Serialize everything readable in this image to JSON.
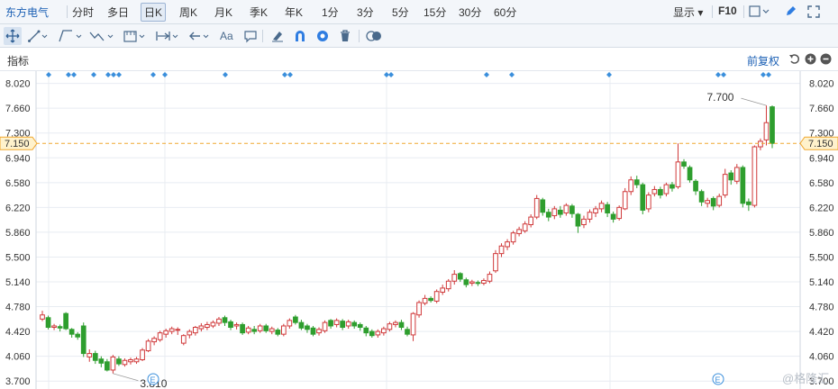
{
  "header": {
    "stock_name": "东方电气",
    "periods": [
      "分时",
      "多日",
      "日K",
      "周K",
      "月K",
      "季K",
      "年K",
      "1分",
      "3分",
      "5分",
      "15分",
      "30分",
      "60分"
    ],
    "active_period": "日K",
    "display_label": "显示",
    "f10_label": "F10"
  },
  "toolbar": {
    "text_tool_label": "Aa"
  },
  "indicator_bar": {
    "label": "指标",
    "adjust_label": "前复权"
  },
  "colors": {
    "up": "#d0393a",
    "down": "#2e9e2e",
    "grid": "#e8ecf2",
    "price_line": "#f0a830",
    "price_tag": "#fff2cc",
    "marker": "#3b8fdc"
  },
  "watermark": "@格隆汇",
  "chart_data": {
    "type": "candlestick",
    "y_ticks": [
      "8.020",
      "7.660",
      "7.300",
      "6.940",
      "6.580",
      "6.220",
      "5.860",
      "5.500",
      "5.140",
      "4.780",
      "4.420",
      "4.060",
      "3.700"
    ],
    "ylim": [
      3.585,
      8.198
    ],
    "current_price": "7.150",
    "high_label": "7.700",
    "low_label": "3.810",
    "event_marker_label": "E",
    "grid": true,
    "candles": [
      [
        4.6,
        4.66,
        4.57,
        4.72
      ],
      [
        4.62,
        4.48,
        4.45,
        4.65
      ],
      [
        4.48,
        4.5,
        4.44,
        4.53
      ],
      [
        4.49,
        4.47,
        4.42,
        4.52
      ],
      [
        4.68,
        4.46,
        4.44,
        4.7
      ],
      [
        4.45,
        4.38,
        4.33,
        4.47
      ],
      [
        4.38,
        4.34,
        4.3,
        4.41
      ],
      [
        4.5,
        4.1,
        4.05,
        4.55
      ],
      [
        4.05,
        4.1,
        3.98,
        4.16
      ],
      [
        4.1,
        4.0,
        3.95,
        4.14
      ],
      [
        4.02,
        3.96,
        3.9,
        4.06
      ],
      [
        3.98,
        3.86,
        3.84,
        4.02
      ],
      [
        3.86,
        4.05,
        3.81,
        4.08
      ],
      [
        4.02,
        3.95,
        3.92,
        4.06
      ],
      [
        3.94,
        4.0,
        3.91,
        4.03
      ],
      [
        3.98,
        4.01,
        3.94,
        4.04
      ],
      [
        3.98,
        4.02,
        3.95,
        4.05
      ],
      [
        4.01,
        4.15,
        3.99,
        4.18
      ],
      [
        4.14,
        4.28,
        4.12,
        4.31
      ],
      [
        4.27,
        4.32,
        4.22,
        4.35
      ],
      [
        4.3,
        4.4,
        4.27,
        4.43
      ],
      [
        4.38,
        4.43,
        4.33,
        4.46
      ],
      [
        4.42,
        4.46,
        4.38,
        4.49
      ],
      [
        4.44,
        4.45,
        4.37,
        4.48
      ],
      [
        4.25,
        4.36,
        4.22,
        4.38
      ],
      [
        4.37,
        4.42,
        4.32,
        4.45
      ],
      [
        4.4,
        4.48,
        4.36,
        4.5
      ],
      [
        4.46,
        4.5,
        4.42,
        4.54
      ],
      [
        4.48,
        4.52,
        4.44,
        4.56
      ],
      [
        4.5,
        4.55,
        4.47,
        4.58
      ],
      [
        4.54,
        4.6,
        4.5,
        4.63
      ],
      [
        4.62,
        4.55,
        4.5,
        4.65
      ],
      [
        4.56,
        4.48,
        4.44,
        4.59
      ],
      [
        4.5,
        4.52,
        4.45,
        4.55
      ],
      [
        4.52,
        4.4,
        4.37,
        4.55
      ],
      [
        4.41,
        4.47,
        4.38,
        4.5
      ],
      [
        4.45,
        4.42,
        4.38,
        4.5
      ],
      [
        4.43,
        4.5,
        4.4,
        4.53
      ],
      [
        4.5,
        4.43,
        4.4,
        4.53
      ],
      [
        4.42,
        4.46,
        4.38,
        4.49
      ],
      [
        4.44,
        4.38,
        4.35,
        4.47
      ],
      [
        4.38,
        4.5,
        4.35,
        4.53
      ],
      [
        4.5,
        4.58,
        4.46,
        4.61
      ],
      [
        4.63,
        4.55,
        4.52,
        4.66
      ],
      [
        4.55,
        4.47,
        4.44,
        4.59
      ],
      [
        4.5,
        4.45,
        4.4,
        4.53
      ],
      [
        4.47,
        4.38,
        4.35,
        4.5
      ],
      [
        4.4,
        4.45,
        4.36,
        4.48
      ],
      [
        4.43,
        4.55,
        4.4,
        4.58
      ],
      [
        4.58,
        4.5,
        4.46,
        4.6
      ],
      [
        4.52,
        4.58,
        4.48,
        4.61
      ],
      [
        4.57,
        4.48,
        4.44,
        4.6
      ],
      [
        4.5,
        4.56,
        4.46,
        4.59
      ],
      [
        4.55,
        4.5,
        4.46,
        4.58
      ],
      [
        4.52,
        4.48,
        4.43,
        4.55
      ],
      [
        4.47,
        4.4,
        4.35,
        4.5
      ],
      [
        4.42,
        4.36,
        4.33,
        4.45
      ],
      [
        4.37,
        4.42,
        4.33,
        4.45
      ],
      [
        4.4,
        4.46,
        4.36,
        4.49
      ],
      [
        4.45,
        4.53,
        4.42,
        4.56
      ],
      [
        4.52,
        4.55,
        4.48,
        4.58
      ],
      [
        4.55,
        4.48,
        4.44,
        4.59
      ],
      [
        4.45,
        4.38,
        4.35,
        4.49
      ],
      [
        4.37,
        4.68,
        4.28,
        4.7
      ],
      [
        4.66,
        4.84,
        4.62,
        4.87
      ],
      [
        4.83,
        4.9,
        4.8,
        4.95
      ],
      [
        4.9,
        4.87,
        4.84,
        4.93
      ],
      [
        4.86,
        5.0,
        4.83,
        5.03
      ],
      [
        4.99,
        5.05,
        4.95,
        5.1
      ],
      [
        5.04,
        5.15,
        5.0,
        5.18
      ],
      [
        5.15,
        5.25,
        5.1,
        5.31
      ],
      [
        5.26,
        5.18,
        5.14,
        5.28
      ],
      [
        5.17,
        5.1,
        5.06,
        5.2
      ],
      [
        5.12,
        5.14,
        5.08,
        5.17
      ],
      [
        5.13,
        5.12,
        5.08,
        5.16
      ],
      [
        5.12,
        5.16,
        5.09,
        5.19
      ],
      [
        5.15,
        5.25,
        5.12,
        5.29
      ],
      [
        5.3,
        5.55,
        5.27,
        5.6
      ],
      [
        5.55,
        5.66,
        5.5,
        5.7
      ],
      [
        5.65,
        5.72,
        5.6,
        5.76
      ],
      [
        5.72,
        5.85,
        5.68,
        5.88
      ],
      [
        5.84,
        5.9,
        5.8,
        5.94
      ],
      [
        5.88,
        5.98,
        5.85,
        6.02
      ],
      [
        5.97,
        6.08,
        5.93,
        6.12
      ],
      [
        6.08,
        6.35,
        6.05,
        6.4
      ],
      [
        6.33,
        6.15,
        6.1,
        6.36
      ],
      [
        6.15,
        6.08,
        6.02,
        6.2
      ],
      [
        6.1,
        6.2,
        6.05,
        6.24
      ],
      [
        6.18,
        6.12,
        6.07,
        6.24
      ],
      [
        6.14,
        6.25,
        6.1,
        6.28
      ],
      [
        6.24,
        6.13,
        6.07,
        6.27
      ],
      [
        6.12,
        5.95,
        5.85,
        6.14
      ],
      [
        5.97,
        6.05,
        5.92,
        6.1
      ],
      [
        6.05,
        6.15,
        6.0,
        6.19
      ],
      [
        6.14,
        6.2,
        6.08,
        6.24
      ],
      [
        6.2,
        6.28,
        6.15,
        6.32
      ],
      [
        6.26,
        6.14,
        6.08,
        6.3
      ],
      [
        6.12,
        6.05,
        6.0,
        6.16
      ],
      [
        6.06,
        6.22,
        6.03,
        6.25
      ],
      [
        6.2,
        6.45,
        6.18,
        6.5
      ],
      [
        6.45,
        6.62,
        6.4,
        6.67
      ],
      [
        6.62,
        6.55,
        6.5,
        6.68
      ],
      [
        6.55,
        6.18,
        6.12,
        6.58
      ],
      [
        6.2,
        6.4,
        6.15,
        6.44
      ],
      [
        6.42,
        6.48,
        6.38,
        6.53
      ],
      [
        6.48,
        6.4,
        6.35,
        6.52
      ],
      [
        6.42,
        6.55,
        6.38,
        6.58
      ],
      [
        6.55,
        6.5,
        6.45,
        6.59
      ],
      [
        6.52,
        6.88,
        6.49,
        7.15
      ],
      [
        6.88,
        6.82,
        6.78,
        6.92
      ],
      [
        6.8,
        6.62,
        6.58,
        6.83
      ],
      [
        6.6,
        6.46,
        6.4,
        6.63
      ],
      [
        6.45,
        6.3,
        6.24,
        6.48
      ],
      [
        6.28,
        6.32,
        6.22,
        6.36
      ],
      [
        6.35,
        6.24,
        6.18,
        6.38
      ],
      [
        6.25,
        6.38,
        6.22,
        6.42
      ],
      [
        6.4,
        6.7,
        6.36,
        6.78
      ],
      [
        6.72,
        6.62,
        6.55,
        6.76
      ],
      [
        6.6,
        6.8,
        6.56,
        6.85
      ],
      [
        6.8,
        6.28,
        6.22,
        6.83
      ],
      [
        6.3,
        6.26,
        6.17,
        6.35
      ],
      [
        6.25,
        7.1,
        6.22,
        7.12
      ],
      [
        7.1,
        7.18,
        7.05,
        7.22
      ],
      [
        7.2,
        7.45,
        7.12,
        7.7
      ],
      [
        7.68,
        7.15,
        7.08,
        7.7
      ]
    ]
  }
}
